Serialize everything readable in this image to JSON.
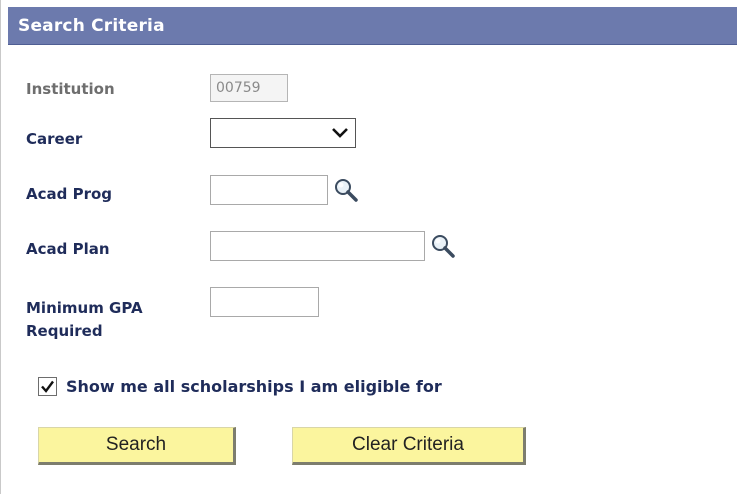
{
  "panel": {
    "title": "Search Criteria"
  },
  "fields": {
    "institution": {
      "label": "Institution",
      "value": "00759"
    },
    "career": {
      "label": "Career",
      "selected": ""
    },
    "acad_prog": {
      "label": "Acad Prog",
      "value": ""
    },
    "acad_plan": {
      "label": "Acad Plan",
      "value": ""
    },
    "min_gpa": {
      "label": "Minimum GPA Required",
      "value": ""
    }
  },
  "eligibility": {
    "label": "Show me all scholarships I am eligible for",
    "checked": true
  },
  "buttons": {
    "search": "Search",
    "clear": "Clear Criteria"
  },
  "icons": {
    "lookup": "magnifier-icon",
    "dropdown": "chevron-down-icon",
    "check": "checkmark-icon"
  },
  "colors": {
    "header_bg": "#6c7aad",
    "label_text": "#1f2c5a",
    "button_bg": "#fbf59e"
  }
}
